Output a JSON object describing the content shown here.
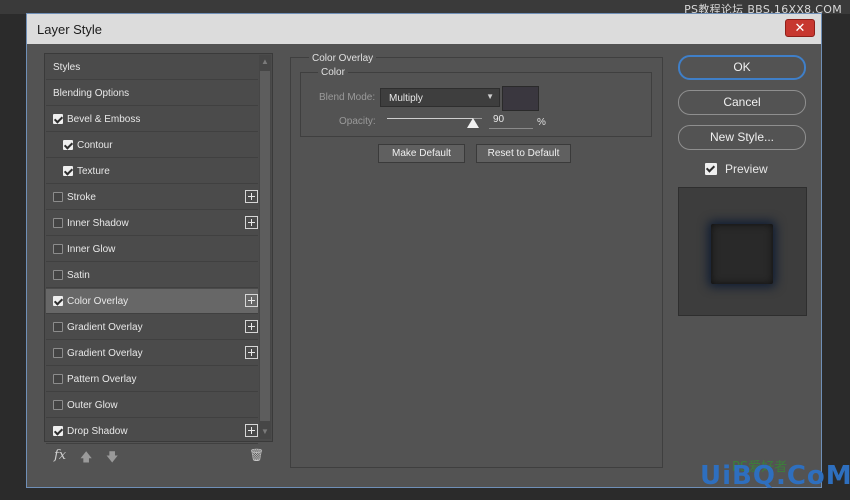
{
  "watermark_top": "PS教程论坛 BBS.16XX8.COM",
  "dialog": {
    "title": "Layer Style",
    "close_glyph": "✕"
  },
  "styles_list": [
    {
      "label": "Styles",
      "checkbox": false,
      "checked": false,
      "plus": false,
      "indent": false,
      "selected": false
    },
    {
      "label": "Blending Options",
      "checkbox": false,
      "checked": false,
      "plus": false,
      "indent": false,
      "selected": false
    },
    {
      "label": "Bevel & Emboss",
      "checkbox": true,
      "checked": true,
      "plus": false,
      "indent": false,
      "selected": false
    },
    {
      "label": "Contour",
      "checkbox": true,
      "checked": true,
      "plus": false,
      "indent": true,
      "selected": false
    },
    {
      "label": "Texture",
      "checkbox": true,
      "checked": true,
      "plus": false,
      "indent": true,
      "selected": false
    },
    {
      "label": "Stroke",
      "checkbox": true,
      "checked": false,
      "plus": true,
      "indent": false,
      "selected": false
    },
    {
      "label": "Inner Shadow",
      "checkbox": true,
      "checked": false,
      "plus": true,
      "indent": false,
      "selected": false
    },
    {
      "label": "Inner Glow",
      "checkbox": true,
      "checked": false,
      "plus": false,
      "indent": false,
      "selected": false
    },
    {
      "label": "Satin",
      "checkbox": true,
      "checked": false,
      "plus": false,
      "indent": false,
      "selected": false
    },
    {
      "label": "Color Overlay",
      "checkbox": true,
      "checked": true,
      "plus": true,
      "indent": false,
      "selected": true
    },
    {
      "label": "Gradient Overlay",
      "checkbox": true,
      "checked": false,
      "plus": true,
      "indent": false,
      "selected": false
    },
    {
      "label": "Gradient Overlay",
      "checkbox": true,
      "checked": false,
      "plus": true,
      "indent": false,
      "selected": false
    },
    {
      "label": "Pattern Overlay",
      "checkbox": true,
      "checked": false,
      "plus": false,
      "indent": false,
      "selected": false
    },
    {
      "label": "Outer Glow",
      "checkbox": true,
      "checked": false,
      "plus": false,
      "indent": false,
      "selected": false
    },
    {
      "label": "Drop Shadow",
      "checkbox": true,
      "checked": true,
      "plus": true,
      "indent": false,
      "selected": false
    }
  ],
  "bottom_bar": {
    "fx_label": "fx",
    "up_glyph": "🡅",
    "down_glyph": "🡇",
    "trash_glyph": "🗑"
  },
  "color_overlay": {
    "section_title": "Color Overlay",
    "group_title": "Color",
    "blend_mode_label": "Blend Mode:",
    "blend_mode_value": "Multiply",
    "overlay_color": "#3a373f",
    "opacity_label": "Opacity:",
    "opacity_value": "90",
    "opacity_unit": "%",
    "opacity_fraction": 0.9,
    "make_default_label": "Make Default",
    "reset_default_label": "Reset to Default"
  },
  "right_panel": {
    "ok_label": "OK",
    "cancel_label": "Cancel",
    "new_style_label": "New Style...",
    "preview_label": "Preview",
    "preview_checked": true
  },
  "watermark_bottom": "UiBQ.CoM",
  "watermark_bottom_small": "PS爱好者"
}
